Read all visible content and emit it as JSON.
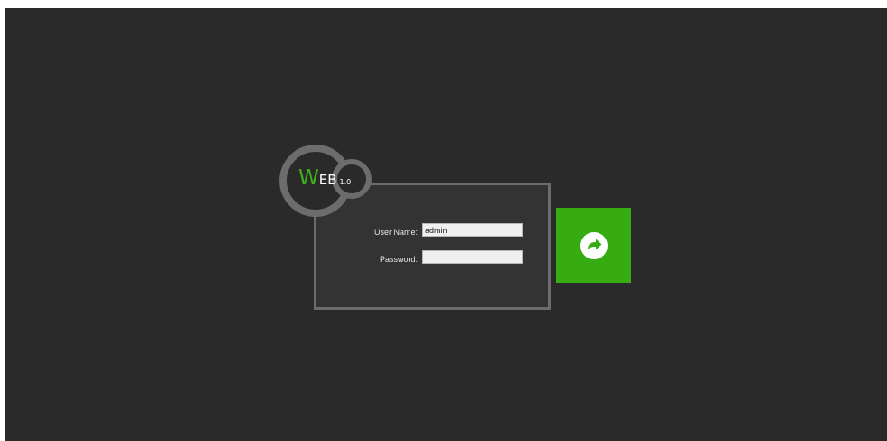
{
  "logo": {
    "initial": "W",
    "rest": "EB",
    "version": "1.0",
    "icon": "web-logo-rings-icon"
  },
  "form": {
    "username_label": "User Name:",
    "username_value": "admin",
    "password_label": "Password:",
    "password_value": ""
  },
  "submit": {
    "icon": "arrow-right-circle-icon"
  },
  "colors": {
    "accent": "#36ac12",
    "logo_green": "#3fb21b",
    "background": "#2a2a2a",
    "panel": "#333333",
    "border": "#6c6c6c"
  }
}
